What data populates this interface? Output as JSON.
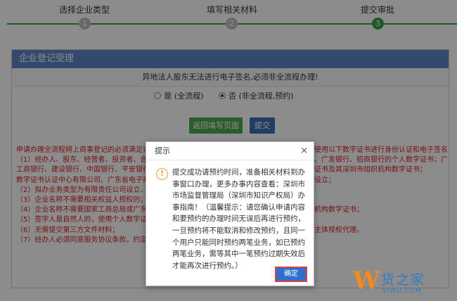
{
  "steps": [
    {
      "label": "选择企业类型",
      "num": "1",
      "active": false
    },
    {
      "label": "填写相关材料",
      "num": "2",
      "active": false
    },
    {
      "label": "提交审批",
      "num": "3",
      "active": true
    }
  ],
  "panel": {
    "title": "企业登记受理",
    "notice": "异地法人股东无法进行电子签名,必须非全流程办理!",
    "radio_full": "是 (全流程)",
    "radio_partial": "否 (非全流程,预约)",
    "selected": "partial",
    "back_label": "返回填写页面",
    "submit_label": "提交"
  },
  "rules": [
    "申请办理全流程网上商事登记的必须满足以下",
    "（1）经办人、股东、经营者、投资者、合伙人",
    "工商银行、建设银行、中国银行、平安银行、",
    "数字证书认证中心有限公司、广东省电子商务",
    "（2）拟办业务类型为有限责任公司设立、个人",
    "（3）企业名称不需要相关权益人授权的；",
    "（4）企业名称不需要国家工商总局或广东省工",
    "（5）签字人是自然人的，使用个人数字证书；",
    "（6）无需提交第三方文件材料；",
    "（7）经办人必须同意服务协议条款，约定使用"
  ],
  "rules_right": [
    "使用以下数字证书进行身份认证和电子签名：",
    "、广发银行、招商银行的个人数字证书；广东省",
    "证书及其深圳市组织机构数字证书；",
    "设立；",
    "",
    "",
    "机构数字证书；",
    "",
    "主体授权代理。"
  ],
  "dialog": {
    "title": "提示",
    "close": "×",
    "icon": "!",
    "message": "提交成功请预约时间，准备相关材料到办事窗口办理，更多办事内容查看：深圳市市场监督管理局（深圳市知识产权局）办事指南！（温馨提示：请您确认申请内容和要预约的办理时间无误后再进行预约，一旦预约将不能取消和修改预约，且同一个用户只能同时预约两笔业务，如已预约两笔业务，需等其中一笔预约过期失效后才能再次进行预约。）",
    "ok_label": "确定"
  },
  "watermark": {
    "mark": "W",
    "text": "货之家",
    "url": "SIWU.COM"
  }
}
